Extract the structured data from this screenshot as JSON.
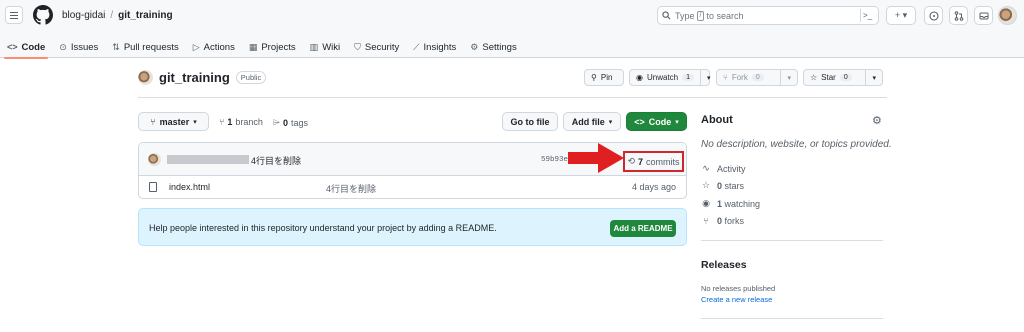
{
  "header": {
    "owner": "blog-gidai",
    "separator": "/",
    "repo": "git_training",
    "search_placeholder_before": "Type",
    "search_key": "/",
    "search_placeholder_after": "to search",
    "command_icon": ">_",
    "plus_label": "+ ▾"
  },
  "nav_tabs": [
    {
      "label": "Code",
      "icon": "code-icon"
    },
    {
      "label": "Issues",
      "icon": "issue-icon"
    },
    {
      "label": "Pull requests",
      "icon": "pull-request-icon"
    },
    {
      "label": "Actions",
      "icon": "play-icon"
    },
    {
      "label": "Projects",
      "icon": "table-icon"
    },
    {
      "label": "Wiki",
      "icon": "book-icon"
    },
    {
      "label": "Security",
      "icon": "shield-icon"
    },
    {
      "label": "Insights",
      "icon": "graph-icon"
    },
    {
      "label": "Settings",
      "icon": "gear-icon"
    }
  ],
  "repo_header": {
    "name": "git_training",
    "visibility": "Public",
    "pin_label": "Pin",
    "watch_label": "Unwatch",
    "watch_count": "1",
    "fork_label": "Fork",
    "fork_count": "0",
    "star_label": "Star",
    "star_count": "0"
  },
  "toolbar": {
    "branch": "master",
    "branches_count": "1",
    "branches_label": "branch",
    "tags_count": "0",
    "tags_label": "tags",
    "goto_file": "Go to file",
    "add_file": "Add file",
    "code": "Code"
  },
  "commit": {
    "message": "4行目を削除",
    "hash": "59b93e4",
    "hash_suffix": "o",
    "commits_count": "7",
    "commits_label": "commits"
  },
  "files": [
    {
      "name": "index.html",
      "message": "4行目を削除",
      "date": "4 days ago"
    }
  ],
  "readme_banner": {
    "text": "Help people interested in this repository understand your project by adding a README.",
    "button": "Add a README"
  },
  "about": {
    "title": "About",
    "description": "No description, website, or topics provided.",
    "activity": "Activity",
    "stars_count": "0",
    "stars_label": "stars",
    "watching_count": "1",
    "watching_label": "watching",
    "forks_count": "0",
    "forks_label": "forks"
  },
  "releases": {
    "title": "Releases",
    "none": "No releases published",
    "create_link": "Create a new release"
  },
  "colors": {
    "accent_green": "#1f883d",
    "tab_underline": "#fd8c73",
    "highlight_red": "#d0262d",
    "banner_blue": "#ddf4ff",
    "link_blue": "#0969da"
  }
}
